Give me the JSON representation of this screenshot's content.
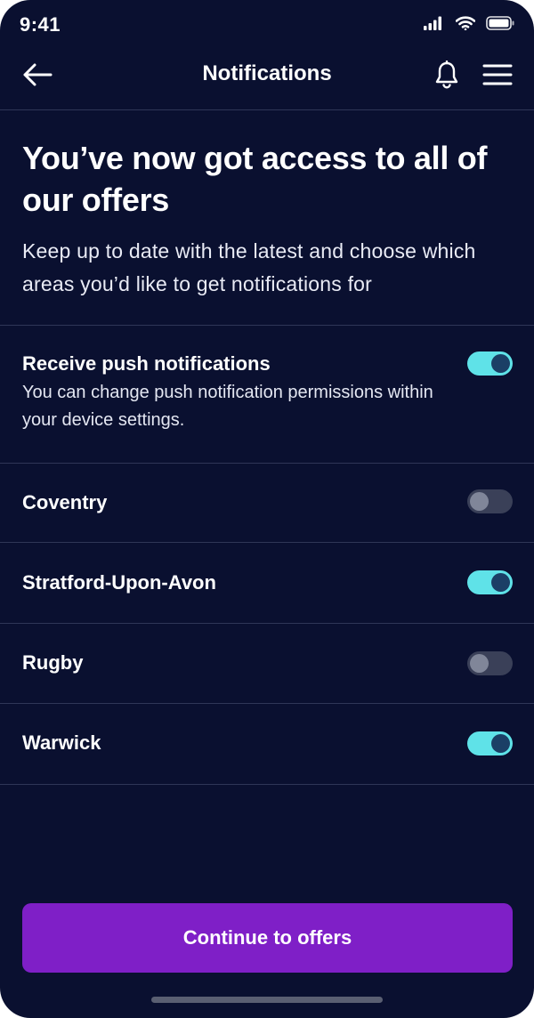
{
  "status_bar": {
    "time": "9:41",
    "icons": [
      "signal-icon",
      "wifi-icon",
      "battery-icon"
    ]
  },
  "header": {
    "title": "Notifications",
    "icons": [
      "back-arrow-icon",
      "bell-icon",
      "menu-icon"
    ]
  },
  "intro": {
    "heading": "You’ve now got access to all of our offers",
    "text": "Keep up to date with the latest and choose which areas you’d like to get notifications for"
  },
  "push": {
    "title": "Receive push notifications",
    "description": "You can change push notification permissions within your device settings.",
    "enabled": true
  },
  "regions": [
    {
      "label": "Coventry",
      "enabled": false
    },
    {
      "label": "Stratford-Upon-Avon",
      "enabled": true
    },
    {
      "label": "Rugby",
      "enabled": false
    },
    {
      "label": "Warwick",
      "enabled": true
    }
  ],
  "continue_button": {
    "label": "Continue to offers"
  },
  "colors": {
    "background": "#0a1030",
    "toggle_on": "#5fe2e8",
    "toggle_off": "#3a4058",
    "primary_button": "#7f1fc7",
    "divider": "#2f3657"
  }
}
